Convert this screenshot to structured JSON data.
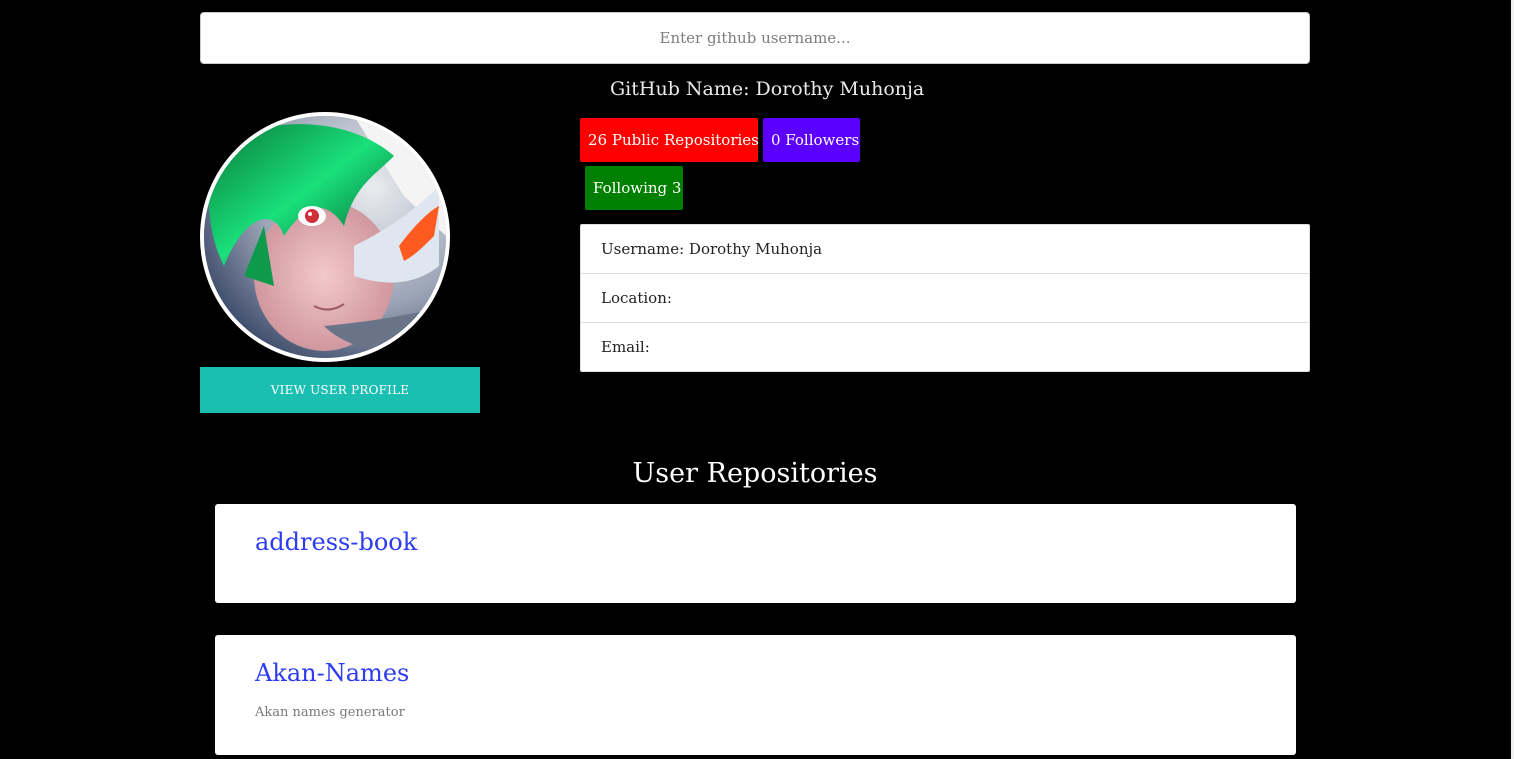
{
  "search": {
    "placeholder": "Enter github username...",
    "value": ""
  },
  "profile": {
    "github_name_text": "GitHub Name: Dorothy Muhonja",
    "view_profile_label": "VIEW USER PROFILE",
    "badges": {
      "repos": "26 Public Repositories",
      "followers": "0 Followers",
      "following": "Following 3"
    },
    "info": {
      "username": "Username: Dorothy Muhonja",
      "location": "Location:",
      "email": "Email:"
    }
  },
  "repositories": {
    "title": "User Repositories",
    "items": [
      {
        "name": "address-book",
        "description": ""
      },
      {
        "name": "Akan-Names",
        "description": "Akan names generator"
      }
    ]
  },
  "colors": {
    "repos_badge": "#ff0000",
    "followers_badge": "#5b00ff",
    "following_badge": "#008000",
    "view_profile_button": "#1bbfb1",
    "repo_link": "#2d3cf0"
  }
}
